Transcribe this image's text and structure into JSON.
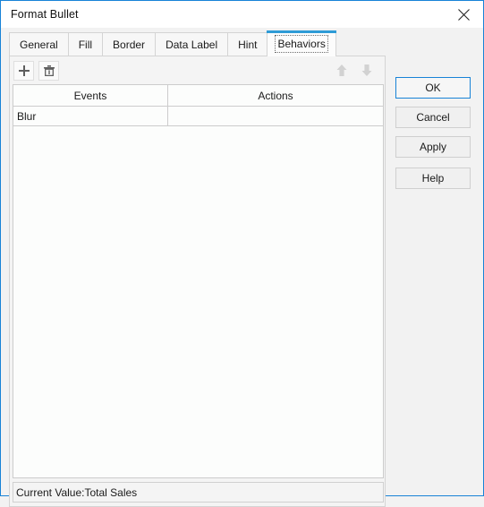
{
  "window": {
    "title": "Format Bullet",
    "close_icon": "close-icon",
    "accent_color": "#1883d7",
    "tab_accent_color": "#2e9bd6"
  },
  "tabs": [
    {
      "label": "General",
      "active": false
    },
    {
      "label": "Fill",
      "active": false
    },
    {
      "label": "Border",
      "active": false
    },
    {
      "label": "Data Label",
      "active": false
    },
    {
      "label": "Hint",
      "active": false
    },
    {
      "label": "Behaviors",
      "active": true
    }
  ],
  "toolbar": {
    "add_icon": "plus-icon",
    "delete_icon": "trash-icon",
    "move_up_icon": "arrow-up-icon",
    "move_down_icon": "arrow-down-icon"
  },
  "grid": {
    "columns": [
      "Events",
      "Actions"
    ],
    "rows": [
      {
        "event": "Blur",
        "action": ""
      }
    ]
  },
  "statusbar": {
    "text": "Current Value:Total Sales"
  },
  "buttons": {
    "ok": "OK",
    "cancel": "Cancel",
    "apply": "Apply",
    "help": "Help"
  }
}
